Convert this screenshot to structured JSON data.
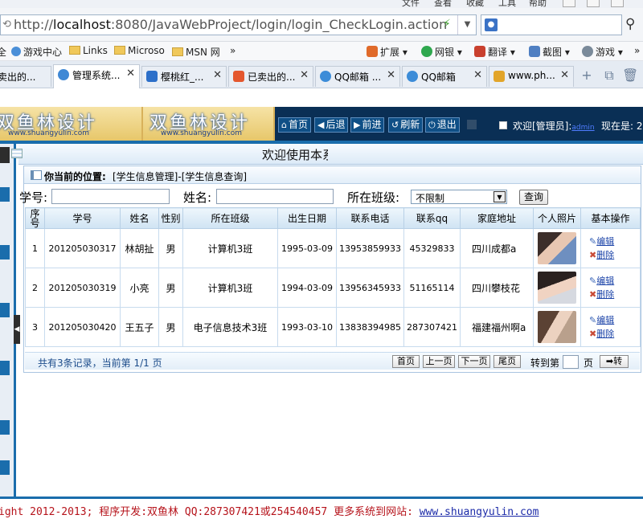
{
  "browser": {
    "menu": [
      "文件",
      "查看",
      "收藏",
      "工具",
      "帮助"
    ],
    "url_prefix": "http://",
    "url_host": "localhost",
    "url_rest": ":8080/JavaWebProject/login/login_CheckLogin.action",
    "favorites": [
      "全",
      "游戏中心",
      "Links",
      "Microso",
      "MSN 网",
      "»"
    ],
    "tools": [
      "扩展",
      "网银",
      "翻译",
      "截图",
      "游戏",
      "»"
    ],
    "tabs": [
      "卖出的...",
      "管理系统...",
      "樱桃红_...",
      "已卖出的...",
      "QQ邮箱 ...",
      "QQ邮箱",
      "www.ph..."
    ],
    "tab_close": "✕"
  },
  "header": {
    "banner_title": "双鱼林设计",
    "banner_site": "www.shuangyulin.com",
    "nav": [
      "首页",
      "后退",
      "前进",
      "刷新",
      "退出"
    ],
    "welcome_prefix": "欢迎[管理员]:",
    "welcome_user": "admin",
    "now_label": "现在是: 2"
  },
  "page": {
    "title": "欢迎使用本系统",
    "location_label": "你当前的位置:",
    "location_path": "[学生信息管理]-[学生信息查询]"
  },
  "search": {
    "student_no_label": "学号:",
    "name_label": "姓名:",
    "class_label": "所在班级:",
    "class_value": "不限制",
    "button": "查询"
  },
  "table": {
    "headers": [
      "序号",
      "学号",
      "姓名",
      "性别",
      "所在班级",
      "出生日期",
      "联系电话",
      "联系qq",
      "家庭地址",
      "个人照片",
      "基本操作"
    ],
    "rows": [
      {
        "seq": "1",
        "no": "201205030317",
        "name": "林胡扯",
        "gender": "男",
        "class": "计算机3班",
        "birth": "1995-03-09",
        "phone": "13953859933",
        "qq": "45329833",
        "address": "四川成都a",
        "edit": "编辑",
        "delete": "删除"
      },
      {
        "seq": "2",
        "no": "201205030319",
        "name": "小亮",
        "gender": "男",
        "class": "计算机3班",
        "birth": "1994-03-09",
        "phone": "13956345933",
        "qq": "51165114",
        "address": "四川攀枝花",
        "edit": "编辑",
        "delete": "删除"
      },
      {
        "seq": "3",
        "no": "201205030420",
        "name": "王五子",
        "gender": "男",
        "class": "电子信息技术3班",
        "birth": "1993-03-10",
        "phone": "13838394985",
        "qq": "287307421",
        "address": "福建福州啊a",
        "edit": "编辑",
        "delete": "删除"
      }
    ]
  },
  "pager": {
    "summary": "共有3条记录，当前第 1/1 页",
    "buttons": [
      "首页",
      "上一页",
      "下一页",
      "尾页"
    ],
    "jump_label": "转到第",
    "jump_unit": "页",
    "go": "转"
  },
  "footer": {
    "text": "ight 2012-2013; 程序开发:双鱼林  QQ:287307421或254540457  更多系统到网站: ",
    "link": "www.shuangyulin.com"
  }
}
